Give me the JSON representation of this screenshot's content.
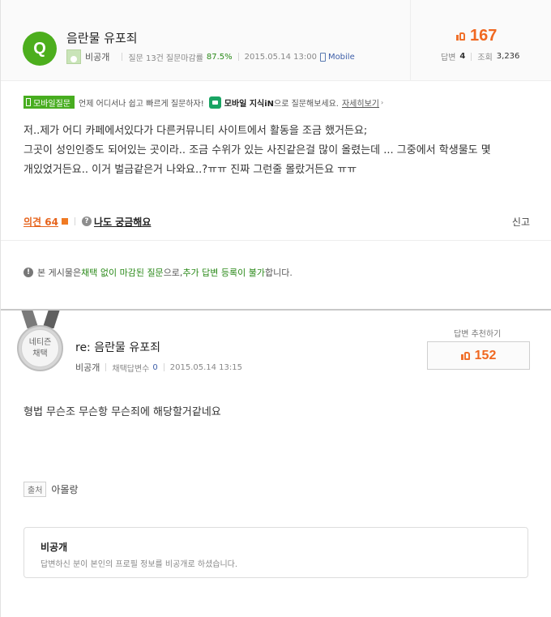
{
  "question": {
    "badge": "Q",
    "title": "음란물 유포죄",
    "author": "비공개",
    "meta": {
      "question_count_label": "질문 13건",
      "close_rate_label": "질문마감률",
      "close_rate": "87.5%",
      "date": "2015.05.14 13:00",
      "platform": "Mobile"
    },
    "likes": "167",
    "answers_label": "답변",
    "answers": "4",
    "views_label": "조회",
    "views": "3,236"
  },
  "mobile_notice": {
    "tag": "모바일질문",
    "text": "언제 어디서나 쉽고 빠르게 질문하자!",
    "kin_bold": "모바일 지식iN",
    "kin_text": "으로 질문해보세요.",
    "detail_link": "자세히보기"
  },
  "question_body": [
    "저..제가 어디 카페에서있다가 다른커뮤니티 사이트에서 활동을 조금 했거든요;",
    "그곳이 성인인증도 되어있는 곳이라.. 조금 수위가 있는 사진같은걸 많이 올렸는데 ... 그중에서 학생물도 몇",
    "개있었거든요.. 이거 벌금같은거 나와요..?ㅠㅠ 진짜 그런줄 몰랐거든요 ㅠㅠ"
  ],
  "actions": {
    "opinion": "의견 64",
    "curious": "나도 궁금해요",
    "report": "신고"
  },
  "closed_notice": {
    "prefix": "본 게시물은 ",
    "g1": "채택 없이 마감된 질문",
    "mid": "으로, ",
    "g2": "추가 답변 등록이 불가",
    "suffix": "합니다."
  },
  "answer": {
    "medal_line1": "네티즌",
    "medal_line2": "채택",
    "title": "re: 음란물 유포죄",
    "author": "비공개",
    "adopted_label": "채택답변수",
    "adopted_count": "0",
    "date": "2015.05.14 13:15",
    "recommend_label": "답변 추천하기",
    "recommend_count": "152",
    "body": "형법 무슨조 무슨항 무슨죄에 해당할거같네요",
    "source_tag": "출처",
    "source": "아몰랑",
    "private_title": "비공개",
    "private_desc": "답변하신 분이 본인의 프로필 정보를 비공개로 하셨습니다."
  },
  "colors": {
    "brand_green": "#4cae1d",
    "like_orange": "#f06821",
    "link_blue": "#3d5ea8"
  }
}
